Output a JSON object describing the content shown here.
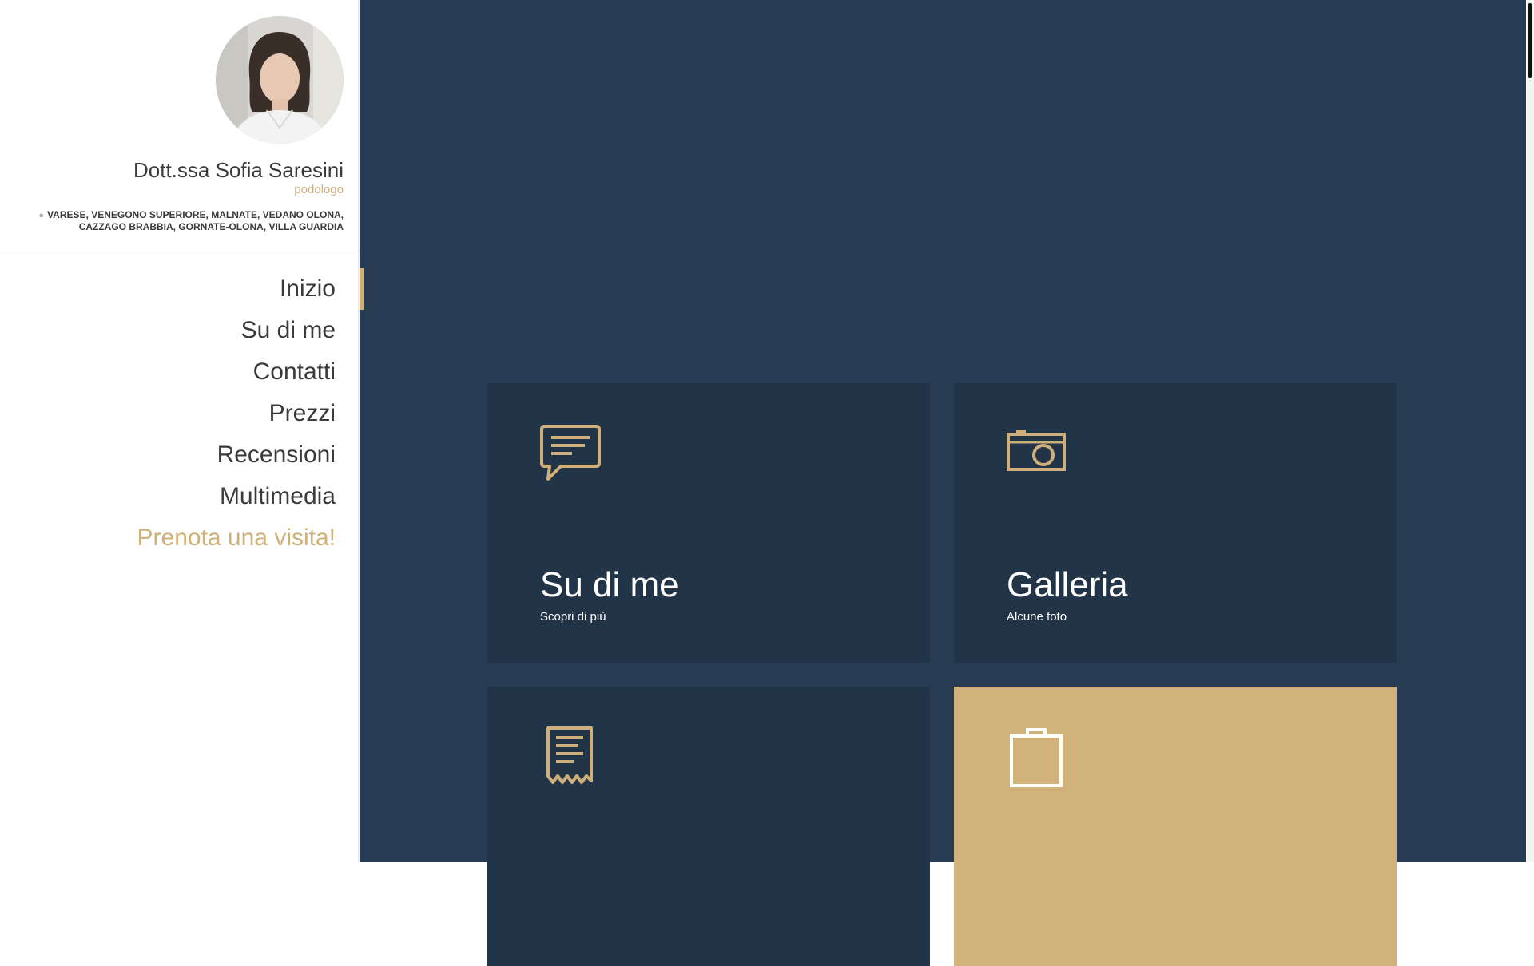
{
  "profile": {
    "name": "Dott.ssa Sofia Saresini",
    "profession": "podologo",
    "location_icon": "map-pin-icon",
    "location": "VARESE, VENEGONO SUPERIORE, MALNATE, VEDANO OLONA, CAZZAGO BRABBIA, GORNATE-OLONA, VILLA GUARDIA"
  },
  "nav": {
    "items": [
      {
        "label": "Inizio",
        "active": true
      },
      {
        "label": "Su di me"
      },
      {
        "label": "Contatti"
      },
      {
        "label": "Prezzi"
      },
      {
        "label": "Recensioni"
      },
      {
        "label": "Multimedia"
      }
    ],
    "cta": "Prenota una visita!"
  },
  "cards": [
    {
      "icon": "speech-bubble-icon",
      "title": "Su di me",
      "subtitle": "Scopri di più"
    },
    {
      "icon": "camera-icon",
      "title": "Galleria",
      "subtitle": "Alcune foto"
    },
    {
      "icon": "receipt-icon",
      "title": "",
      "subtitle": ""
    },
    {
      "icon": "clipboard-icon",
      "title": "",
      "subtitle": ""
    }
  ],
  "colors": {
    "accent": "#d0b07a",
    "main_bg": "#273c52",
    "card_bg": "#223447",
    "text_dark": "#3a3a3a"
  }
}
